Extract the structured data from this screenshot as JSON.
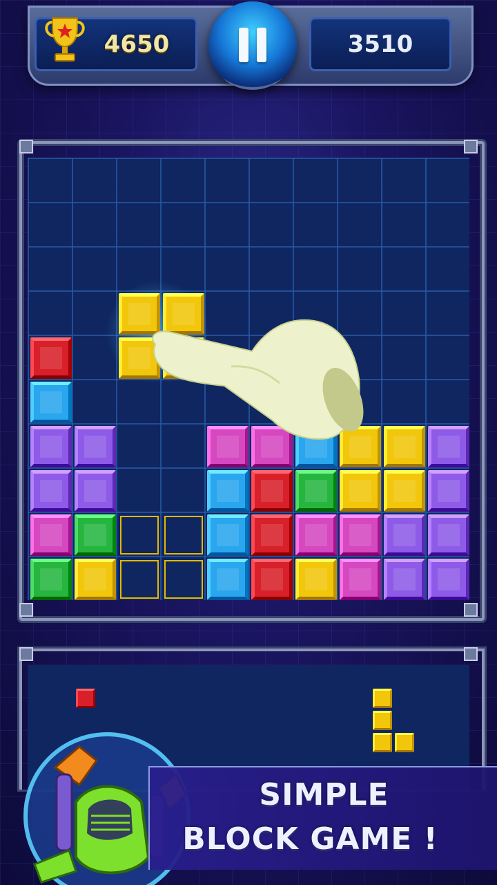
{
  "hud": {
    "best_score": "4650",
    "current_score": "3510",
    "trophy_icon": "trophy-icon",
    "pause_icon": "pause-icon"
  },
  "board": {
    "columns": 10,
    "rows": 10,
    "cells": [
      {
        "r": 4,
        "c": 0,
        "color": "red"
      },
      {
        "r": 5,
        "c": 0,
        "color": "blue"
      },
      {
        "r": 6,
        "c": 0,
        "color": "purple"
      },
      {
        "r": 6,
        "c": 1,
        "color": "purple"
      },
      {
        "r": 6,
        "c": 4,
        "color": "magenta"
      },
      {
        "r": 6,
        "c": 5,
        "color": "magenta"
      },
      {
        "r": 6,
        "c": 6,
        "color": "blue"
      },
      {
        "r": 6,
        "c": 7,
        "color": "yellow"
      },
      {
        "r": 6,
        "c": 8,
        "color": "yellow"
      },
      {
        "r": 6,
        "c": 9,
        "color": "purple"
      },
      {
        "r": 7,
        "c": 0,
        "color": "purple"
      },
      {
        "r": 7,
        "c": 1,
        "color": "purple"
      },
      {
        "r": 7,
        "c": 4,
        "color": "blue"
      },
      {
        "r": 7,
        "c": 5,
        "color": "red"
      },
      {
        "r": 7,
        "c": 6,
        "color": "green"
      },
      {
        "r": 7,
        "c": 7,
        "color": "yellow"
      },
      {
        "r": 7,
        "c": 8,
        "color": "yellow"
      },
      {
        "r": 7,
        "c": 9,
        "color": "purple"
      },
      {
        "r": 8,
        "c": 0,
        "color": "magenta"
      },
      {
        "r": 8,
        "c": 1,
        "color": "green"
      },
      {
        "r": 8,
        "c": 4,
        "color": "blue"
      },
      {
        "r": 8,
        "c": 5,
        "color": "red"
      },
      {
        "r": 8,
        "c": 6,
        "color": "magenta"
      },
      {
        "r": 8,
        "c": 7,
        "color": "magenta"
      },
      {
        "r": 8,
        "c": 8,
        "color": "purple"
      },
      {
        "r": 8,
        "c": 9,
        "color": "purple"
      },
      {
        "r": 9,
        "c": 0,
        "color": "green"
      },
      {
        "r": 9,
        "c": 1,
        "color": "yellow"
      },
      {
        "r": 9,
        "c": 4,
        "color": "blue"
      },
      {
        "r": 9,
        "c": 5,
        "color": "red"
      },
      {
        "r": 9,
        "c": 6,
        "color": "yellow"
      },
      {
        "r": 9,
        "c": 7,
        "color": "magenta"
      },
      {
        "r": 9,
        "c": 8,
        "color": "purple"
      },
      {
        "r": 9,
        "c": 9,
        "color": "purple"
      }
    ],
    "ghost_cells": [
      {
        "r": 8,
        "c": 2
      },
      {
        "r": 8,
        "c": 3
      },
      {
        "r": 9,
        "c": 2
      },
      {
        "r": 9,
        "c": 3
      }
    ],
    "dragging_piece": [
      {
        "r": 3,
        "c": 2,
        "color": "yellow"
      },
      {
        "r": 3,
        "c": 3,
        "color": "yellow"
      },
      {
        "r": 4,
        "c": 2,
        "color": "yellow"
      },
      {
        "r": 4,
        "c": 3,
        "color": "yellow"
      }
    ]
  },
  "tray": {
    "pieces": [
      {
        "name": "small-red",
        "blocks": [
          {
            "r": 0,
            "c": 0,
            "color": "red"
          }
        ]
      },
      {
        "name": "l-piece-yellow",
        "blocks": [
          {
            "r": 0,
            "c": 0,
            "color": "yellow"
          },
          {
            "r": 1,
            "c": 0,
            "color": "yellow"
          },
          {
            "r": 2,
            "c": 0,
            "color": "yellow"
          },
          {
            "r": 2,
            "c": 1,
            "color": "yellow"
          }
        ]
      }
    ]
  },
  "colors": {
    "red": "#d8202a",
    "blue": "#29a6ee",
    "purple": "#8e5ae8",
    "magenta": "#d548c0",
    "green": "#26b640",
    "yellow": "#f2c60a"
  },
  "banner": {
    "line1": "SIMPLE",
    "line2": "BLOCK GAME !"
  }
}
